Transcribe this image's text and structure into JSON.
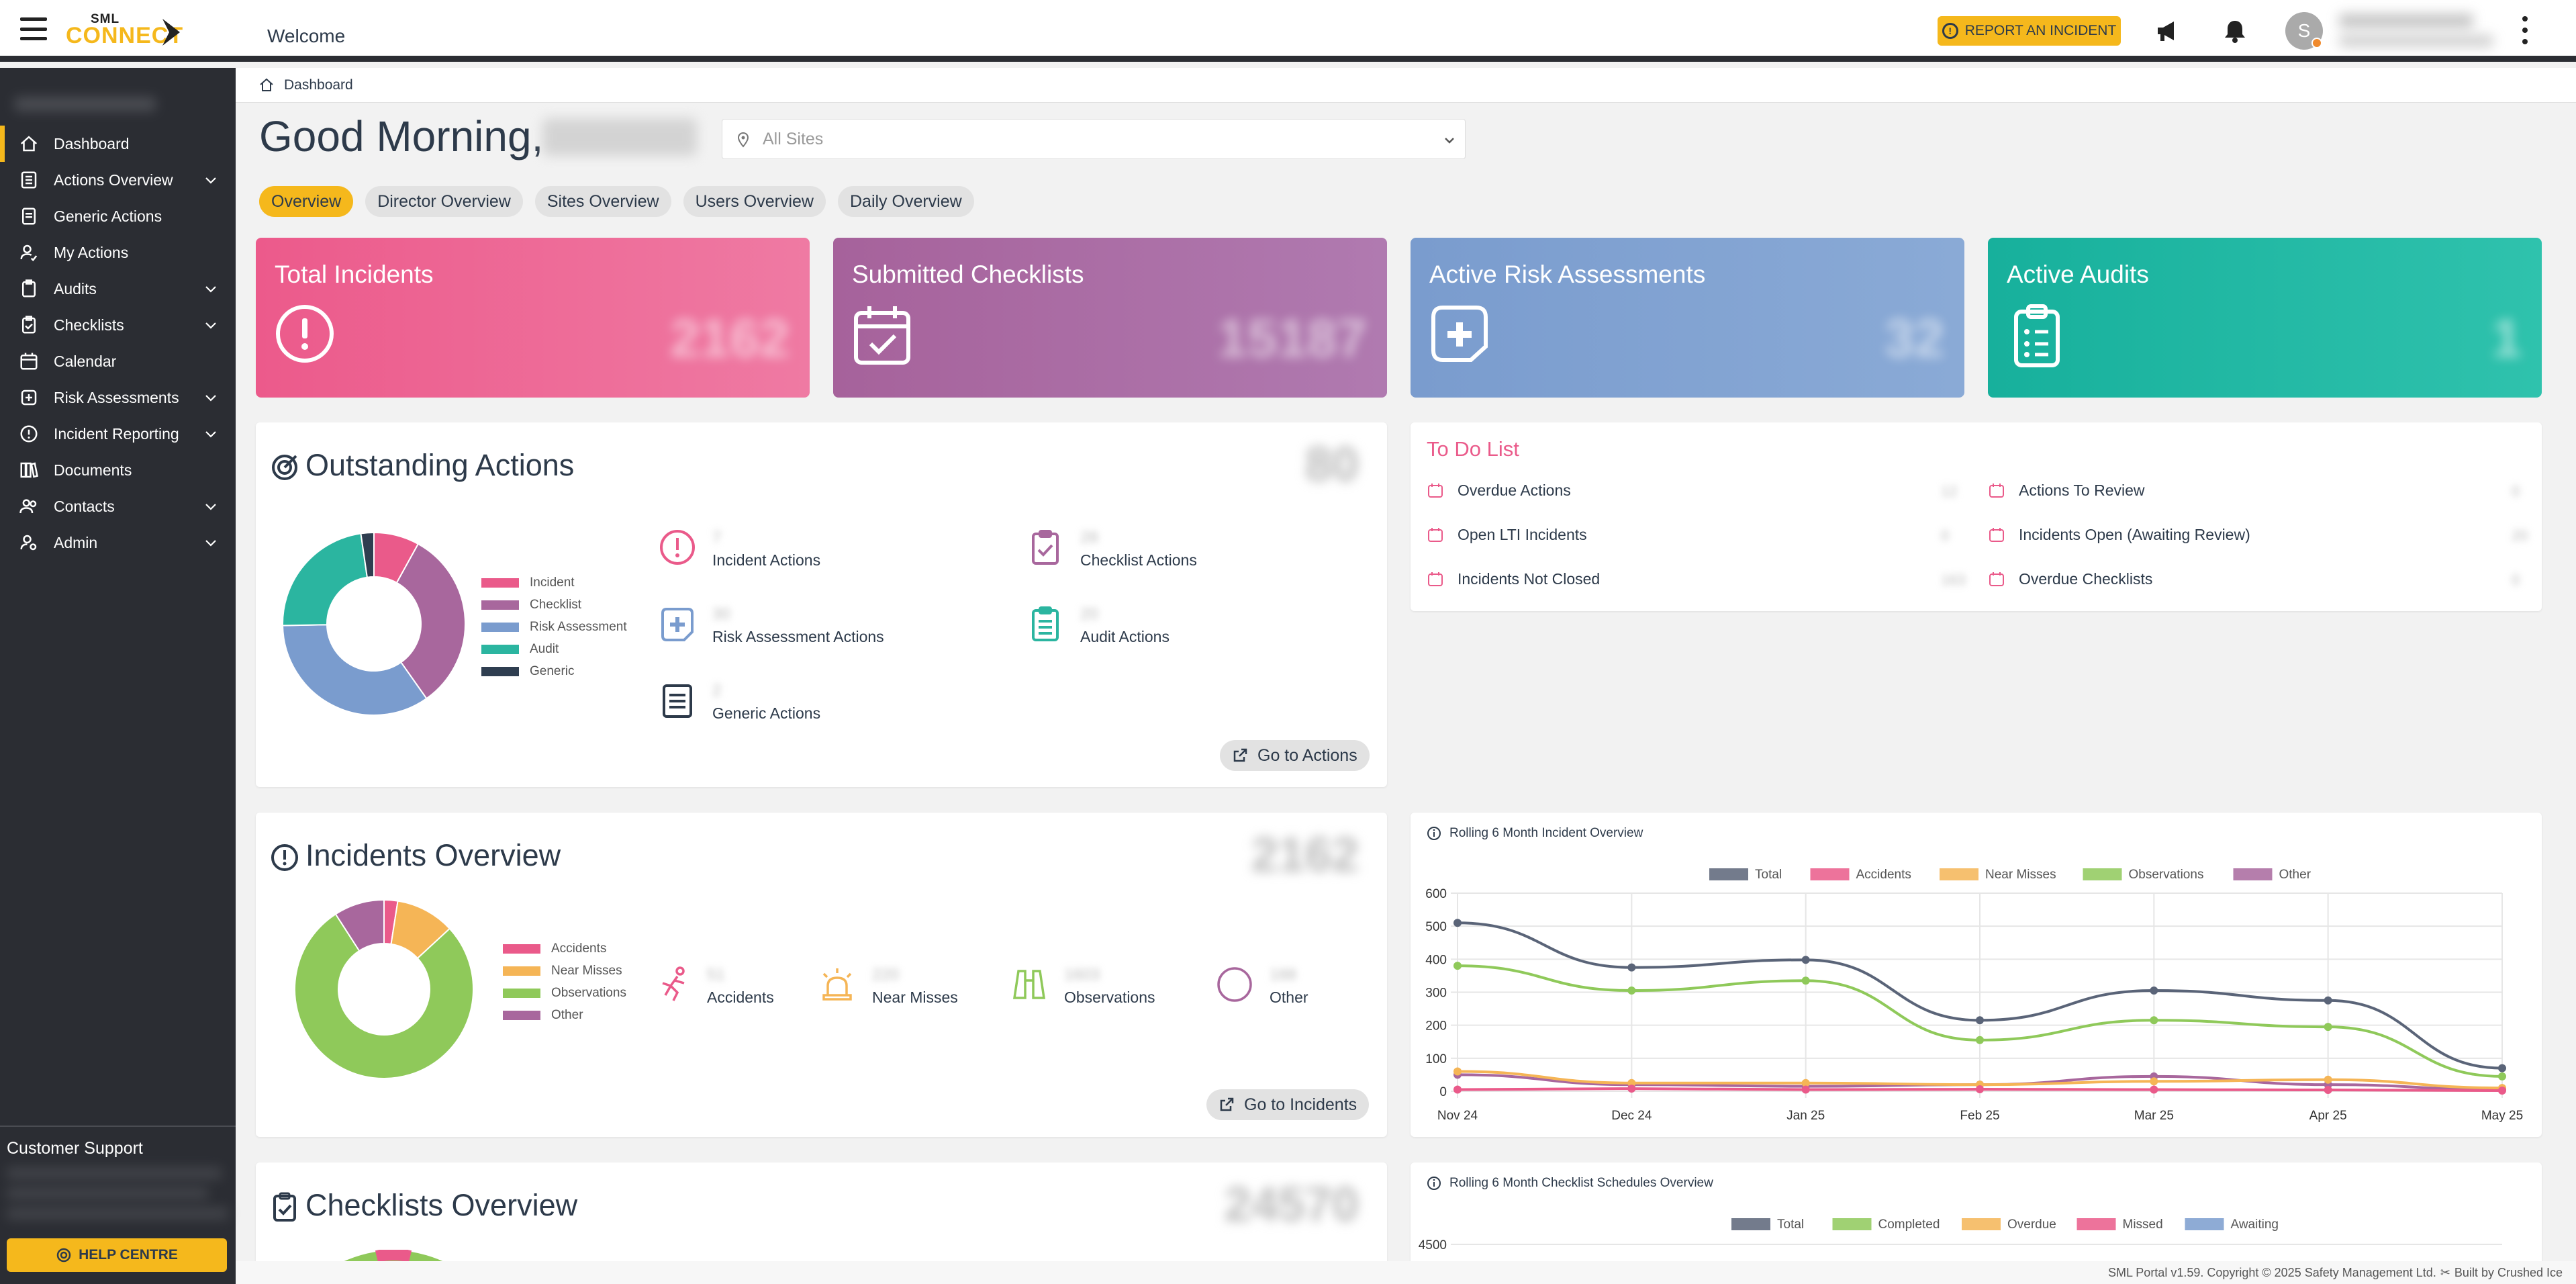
{
  "header": {
    "welcome": "Welcome",
    "report_button": "REPORT AN INCIDENT",
    "avatar_initial": "S",
    "logo_top": "SML",
    "logo_bottom": "CONNECT"
  },
  "sidebar": {
    "items": [
      {
        "label": "Dashboard",
        "icon": "home-icon",
        "expandable": false
      },
      {
        "label": "Actions Overview",
        "icon": "list-icon",
        "expandable": true
      },
      {
        "label": "Generic Actions",
        "icon": "document-icon",
        "expandable": false
      },
      {
        "label": "My Actions",
        "icon": "user-check-icon",
        "expandable": false
      },
      {
        "label": "Audits",
        "icon": "clipboard-icon",
        "expandable": true
      },
      {
        "label": "Checklists",
        "icon": "clipboard-check-icon",
        "expandable": true
      },
      {
        "label": "Calendar",
        "icon": "calendar-icon",
        "expandable": false
      },
      {
        "label": "Risk Assessments",
        "icon": "shield-plus-icon",
        "expandable": true
      },
      {
        "label": "Incident Reporting",
        "icon": "alert-circle-icon",
        "expandable": true
      },
      {
        "label": "Documents",
        "icon": "books-icon",
        "expandable": false
      },
      {
        "label": "Contacts",
        "icon": "users-icon",
        "expandable": true
      },
      {
        "label": "Admin",
        "icon": "user-gear-icon",
        "expandable": true
      }
    ],
    "support_title": "Customer Support",
    "help_button": "HELP CENTRE"
  },
  "breadcrumb": "Dashboard",
  "greeting": "Good Morning,",
  "site_select": {
    "placeholder": "All Sites"
  },
  "tabs": [
    "Overview",
    "Director Overview",
    "Sites Overview",
    "Users Overview",
    "Daily Overview"
  ],
  "kpis": [
    {
      "title": "Total Incidents",
      "value": "2162",
      "color": "#ea5a8a"
    },
    {
      "title": "Submitted Checklists",
      "value": "15187",
      "color": "#a8679d"
    },
    {
      "title": "Active Risk Assessments",
      "value": "32",
      "color": "#7a9cce"
    },
    {
      "title": "Active Audits",
      "value": "1",
      "color": "#1bb3a0"
    }
  ],
  "outstanding": {
    "title": "Outstanding Actions",
    "total": "80",
    "legend": [
      {
        "label": "Incident",
        "color": "#ea5a8a"
      },
      {
        "label": "Checklist",
        "color": "#a8679d"
      },
      {
        "label": "Risk Assessment",
        "color": "#7a9cce"
      },
      {
        "label": "Audit",
        "color": "#2bb5a0"
      },
      {
        "label": "Generic",
        "color": "#2f3e50"
      }
    ],
    "stats": [
      {
        "label": "Incident Actions",
        "value": "7"
      },
      {
        "label": "Checklist Actions",
        "value": "28"
      },
      {
        "label": "Risk Assessment Actions",
        "value": "30"
      },
      {
        "label": "Audit Actions",
        "value": "20"
      },
      {
        "label": "Generic Actions",
        "value": "2"
      }
    ],
    "button": "Go to Actions"
  },
  "todo": {
    "title": "To Do List",
    "items": [
      {
        "label": "Overdue Actions",
        "value": "12"
      },
      {
        "label": "Actions To Review",
        "value": "0"
      },
      {
        "label": "Open LTI Incidents",
        "value": "0"
      },
      {
        "label": "Incidents Open (Awaiting Review)",
        "value": "20"
      },
      {
        "label": "Incidents Not Closed",
        "value": "163"
      },
      {
        "label": "Overdue Checklists",
        "value": "0"
      }
    ]
  },
  "incidents": {
    "title": "Incidents Overview",
    "total": "2162",
    "legend": [
      {
        "label": "Accidents",
        "color": "#ea5a8a"
      },
      {
        "label": "Near Misses",
        "color": "#f5b556"
      },
      {
        "label": "Observations",
        "color": "#8fc95a"
      },
      {
        "label": "Other",
        "color": "#a8679d"
      }
    ],
    "stats": [
      {
        "label": "Accidents",
        "value": "51"
      },
      {
        "label": "Near Misses",
        "value": "220"
      },
      {
        "label": "Observations",
        "value": "1603"
      },
      {
        "label": "Other",
        "value": "188"
      }
    ],
    "button": "Go to Incidents"
  },
  "checklists_overview": {
    "title": "Checklists Overview",
    "total": "24570"
  },
  "chart_data": [
    {
      "type": "line",
      "title": "Rolling 6 Month Incident Overview",
      "x": [
        "Nov 24",
        "Dec 24",
        "Jan 25",
        "Feb 25",
        "Mar 25",
        "Apr 25",
        "May 25"
      ],
      "ylim": [
        0,
        600
      ],
      "yticks": [
        0,
        100,
        200,
        300,
        400,
        500,
        600
      ],
      "legend_position": "top",
      "series": [
        {
          "name": "Total",
          "color": "#5a6478",
          "values": [
            510,
            375,
            398,
            215,
            305,
            275,
            70
          ]
        },
        {
          "name": "Accidents",
          "color": "#ea5a8a",
          "values": [
            5,
            8,
            5,
            6,
            5,
            4,
            2
          ]
        },
        {
          "name": "Near Misses",
          "color": "#f5b556",
          "values": [
            60,
            25,
            25,
            20,
            30,
            35,
            10
          ]
        },
        {
          "name": "Observations",
          "color": "#8fc95a",
          "values": [
            380,
            305,
            335,
            155,
            215,
            195,
            45
          ]
        },
        {
          "name": "Other",
          "color": "#a8679d",
          "values": [
            50,
            20,
            15,
            20,
            45,
            20,
            5
          ]
        }
      ]
    },
    {
      "type": "line",
      "title": "Rolling 6 Month Checklist Schedules Overview",
      "legend_position": "top",
      "yticks": [
        4500
      ],
      "series": [
        {
          "name": "Total",
          "color": "#5a6478"
        },
        {
          "name": "Completed",
          "color": "#8fc95a"
        },
        {
          "name": "Overdue",
          "color": "#f5b556"
        },
        {
          "name": "Missed",
          "color": "#ea5a8a"
        },
        {
          "name": "Awaiting",
          "color": "#7a9cce"
        }
      ]
    }
  ],
  "footer": {
    "text": "SML Portal v1.59. Copyright © 2025 Safety Management Ltd.",
    "built": "Built by Crushed Ice"
  }
}
